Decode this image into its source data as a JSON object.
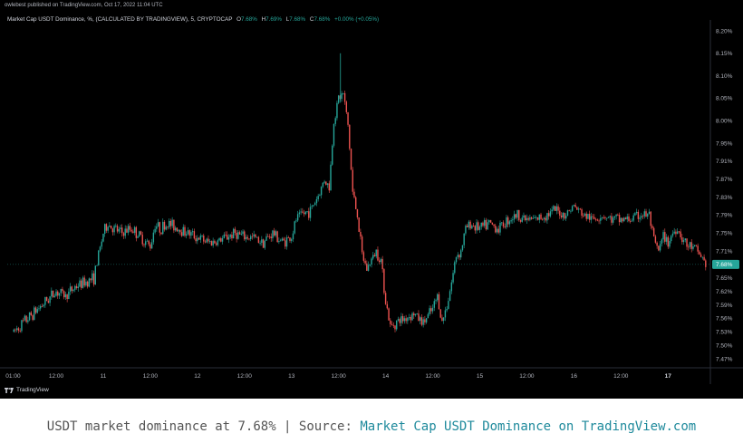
{
  "publisher": "owlebest published on TradingView.com, Oct 17, 2022 11:04 UTC",
  "legend": {
    "title": "Market Cap USDT Dominance, %, (CALCULATED BY TRADINGVIEW), 5, CRYPTOCAP",
    "o_label": "O",
    "o_value": "7.68%",
    "h_label": "H",
    "h_value": "7.69%",
    "l_label": "L",
    "l_value": "7.68%",
    "c_label": "C",
    "c_value": "7.68%",
    "change": "+0.00% (+0.05%)"
  },
  "footer": {
    "brand": "TradingView"
  },
  "caption": {
    "prefix": "USDT market dominance at 7.68% | Source: ",
    "link": "Market Cap USDT Dominance on TradingView.com"
  },
  "colors": {
    "background": "#000000",
    "up": "#26a69a",
    "down": "#ef5350",
    "price_tag": "#26a69a",
    "grid": "#1a1a1a",
    "caption_link": "#1f8a9c"
  },
  "chart_data": {
    "type": "candlestick",
    "title": "Market Cap USDT Dominance, %, (CALCULATED BY TRADINGVIEW), 5, CRYPTOCAP",
    "ylabel": "%",
    "ylim": [
      7.44,
      8.22
    ],
    "y_ticks": [
      "8.20%",
      "8.15%",
      "8.10%",
      "8.05%",
      "8.00%",
      "7.95%",
      "7.91%",
      "7.87%",
      "7.83%",
      "7.79%",
      "7.75%",
      "7.71%",
      "7.65%",
      "7.62%",
      "7.59%",
      "7.56%",
      "7.53%",
      "7.50%",
      "7.47%"
    ],
    "y_tick_values": [
      8.2,
      8.15,
      8.1,
      8.05,
      8.0,
      7.95,
      7.91,
      7.87,
      7.83,
      7.79,
      7.75,
      7.71,
      7.65,
      7.62,
      7.59,
      7.56,
      7.53,
      7.5,
      7.47
    ],
    "x_ticks": [
      "01:00",
      "12:00",
      "11",
      "12:00",
      "12",
      "12:00",
      "13",
      "12:00",
      "14",
      "12:00",
      "15",
      "12:00",
      "16",
      "12:00",
      "17"
    ],
    "x_tick_days": [
      10.042,
      10.5,
      11,
      11.5,
      12,
      12.5,
      13,
      13.5,
      14,
      14.5,
      15,
      15.5,
      16,
      16.5,
      17
    ],
    "x_bold_ticks": [
      "17"
    ],
    "xlim": [
      9.98,
      17.45
    ],
    "last_price": 7.68,
    "last_price_label": "7.68%",
    "grid": false,
    "path_days": [
      10.05,
      10.1,
      10.2,
      10.3,
      10.4,
      10.5,
      10.6,
      10.7,
      10.8,
      10.9,
      10.95,
      11.0,
      11.05,
      11.1,
      11.2,
      11.3,
      11.4,
      11.5,
      11.55,
      11.6,
      11.7,
      11.8,
      11.9,
      12.0,
      12.1,
      12.2,
      12.3,
      12.4,
      12.5,
      12.6,
      12.7,
      12.8,
      12.9,
      13.0,
      13.05,
      13.1,
      13.2,
      13.3,
      13.35,
      13.4,
      13.45,
      13.5,
      13.55,
      13.6,
      13.65,
      13.7,
      13.75,
      13.8,
      13.85,
      13.9,
      13.95,
      14.0,
      14.05,
      14.1,
      14.2,
      14.3,
      14.4,
      14.5,
      14.55,
      14.6,
      14.65,
      14.7,
      14.75,
      14.8,
      14.85,
      14.9,
      15.0,
      15.1,
      15.2,
      15.3,
      15.4,
      15.5,
      15.6,
      15.7,
      15.8,
      15.9,
      16.0,
      16.1,
      16.2,
      16.3,
      16.4,
      16.5,
      16.6,
      16.7,
      16.8,
      16.85,
      16.9,
      16.95,
      17.0,
      17.05,
      17.1,
      17.15,
      17.2,
      17.25,
      17.3,
      17.35,
      17.4
    ],
    "path_values": [
      7.53,
      7.54,
      7.56,
      7.58,
      7.6,
      7.62,
      7.61,
      7.63,
      7.64,
      7.65,
      7.7,
      7.75,
      7.77,
      7.76,
      7.75,
      7.76,
      7.74,
      7.72,
      7.77,
      7.76,
      7.77,
      7.76,
      7.75,
      7.74,
      7.73,
      7.73,
      7.74,
      7.75,
      7.74,
      7.74,
      7.73,
      7.75,
      7.73,
      7.74,
      7.78,
      7.79,
      7.8,
      7.84,
      7.87,
      7.85,
      8.0,
      8.05,
      8.06,
      7.99,
      7.84,
      7.79,
      7.7,
      7.67,
      7.69,
      7.71,
      7.69,
      7.6,
      7.54,
      7.55,
      7.56,
      7.57,
      7.55,
      7.58,
      7.61,
      7.55,
      7.59,
      7.64,
      7.7,
      7.71,
      7.76,
      7.77,
      7.76,
      7.77,
      7.76,
      7.78,
      7.79,
      7.78,
      7.78,
      7.79,
      7.8,
      7.79,
      7.81,
      7.79,
      7.78,
      7.79,
      7.78,
      7.78,
      7.78,
      7.79,
      7.79,
      7.73,
      7.71,
      7.74,
      7.73,
      7.75,
      7.76,
      7.74,
      7.72,
      7.72,
      7.71,
      7.7,
      7.68
    ]
  }
}
